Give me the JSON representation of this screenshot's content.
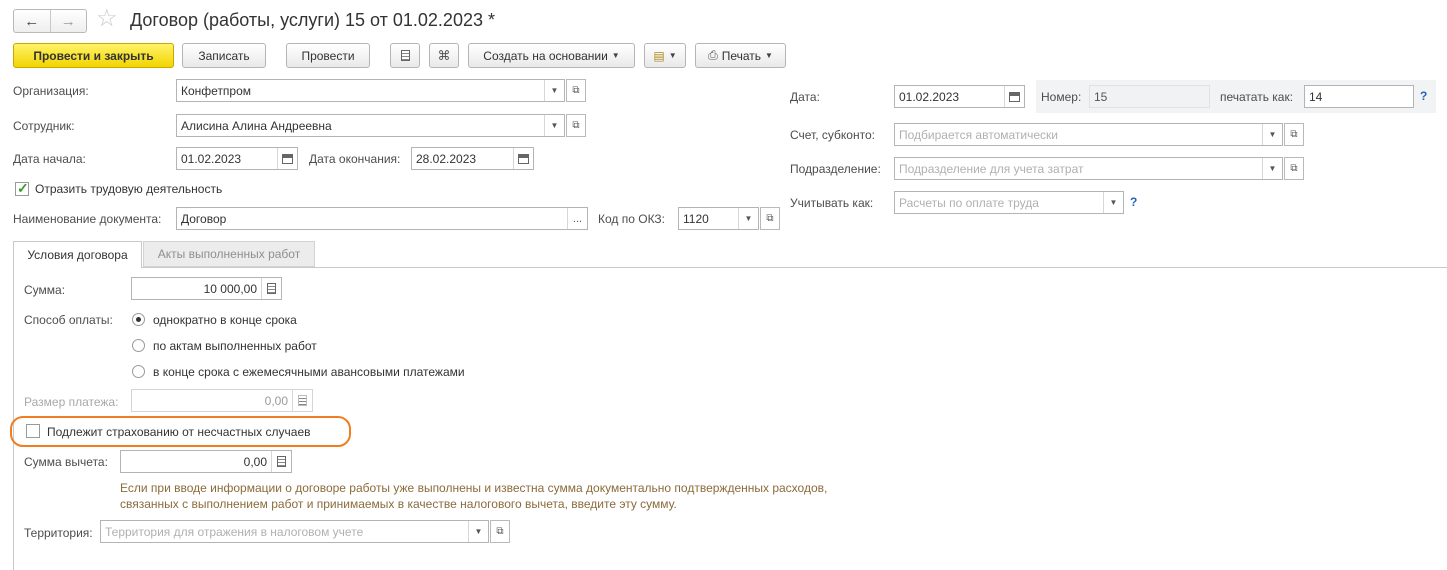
{
  "header": {
    "title": "Договор (работы, услуги) 15 от 01.02.2023 *",
    "nav_back": "←",
    "nav_forward": "→",
    "star": "☆"
  },
  "toolbar": {
    "post_close": "Провести и закрыть",
    "save": "Записать",
    "post": "Провести",
    "create_based": "Создать на основании",
    "print": "Печать"
  },
  "form": {
    "org_label": "Организация:",
    "org_value": "Конфетпром",
    "employee_label": "Сотрудник:",
    "employee_value": "Алисина Алина Андреевна",
    "start_label": "Дата начала:",
    "start_value": "01.02.2023",
    "end_label": "Дата окончания:",
    "end_value": "28.02.2023",
    "labor_check_label": "Отразить трудовую деятельность",
    "labor_checked": true,
    "docname_label": "Наименование документа:",
    "docname_value": "Договор",
    "okz_label": "Код по ОКЗ:",
    "okz_value": "1120",
    "date_label": "Дата:",
    "date_value": "01.02.2023",
    "number_label": "Номер:",
    "number_value": "15",
    "print_as_label": "печатать как:",
    "print_as_value": "14",
    "account_label": "Счет, субконто:",
    "account_placeholder": "Подбирается автоматически",
    "division_label": "Подразделение:",
    "division_placeholder": "Подразделение для учета затрат",
    "account_as_label": "Учитывать как:",
    "account_as_placeholder": "Расчеты по оплате труда",
    "help": "?"
  },
  "tabs": [
    {
      "label": "Условия договора",
      "active": true
    },
    {
      "label": "Акты выполненных работ",
      "active": false
    }
  ],
  "terms": {
    "sum_label": "Сумма:",
    "sum_value": "10 000,00",
    "payment_label": "Способ оплаты:",
    "payment_options": [
      {
        "label": "однократно в конце срока",
        "selected": true
      },
      {
        "label": "по актам выполненных работ",
        "selected": false
      },
      {
        "label": "в конце срока с ежемесячными авансовыми платежами",
        "selected": false
      }
    ],
    "payment_size_label": "Размер платежа:",
    "payment_size_value": "0,00",
    "insurance_label": "Подлежит страхованию от несчастных случаев",
    "insurance_checked": false,
    "deduction_label": "Сумма вычета:",
    "deduction_value": "0,00",
    "hint": "Если при вводе информации о договоре работы уже выполнены и известна сумма документально подтвержденных расходов, связанных с выполнением работ и принимаемых в качестве налогового вычета, введите эту сумму.",
    "territory_label": "Территория:",
    "territory_placeholder": "Территория для отражения в налоговом учете"
  },
  "colors": {
    "primary_button": "#f2d400",
    "highlight_outline": "#ef7d22",
    "help_link": "#2563b8",
    "hint_text": "#8b6b3b"
  }
}
